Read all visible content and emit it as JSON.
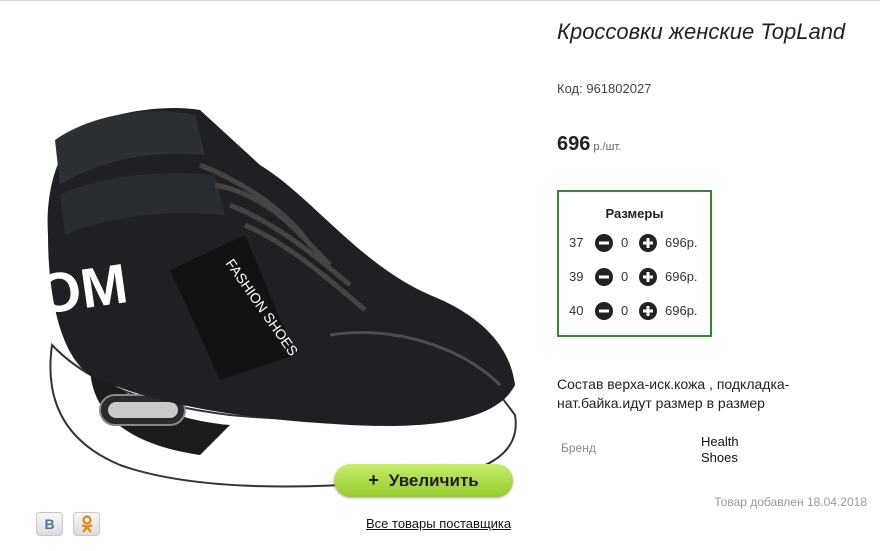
{
  "product": {
    "title": "Кроссовки женские TopLand",
    "code_label": "Код:",
    "code_value": "961802027",
    "price_value": "696",
    "price_unit": "р./шт.",
    "description": "Состав верха-иск.кожа , подкладка-нат.байка.идут размер в размер",
    "brand_label": "Бренд",
    "brand_value": "Health Shoes",
    "added_date": "Товар добавлен 18.04.2018",
    "image_text": "FASHION SHOES"
  },
  "sizes": {
    "title": "Размеры",
    "rows": [
      {
        "size": "37",
        "qty": "0",
        "price": "696р."
      },
      {
        "size": "39",
        "qty": "0",
        "price": "696р."
      },
      {
        "size": "40",
        "qty": "0",
        "price": "696р."
      }
    ]
  },
  "actions": {
    "zoom_plus": "+",
    "zoom_label": "Увеличить",
    "supplier_link": "Все товары поставщика"
  },
  "social": {
    "vk_label": "B",
    "ok_icon": "odnoklassniki-icon"
  },
  "colors": {
    "sizes_border": "#2e8b2e",
    "zoom_button": "#a8d840"
  }
}
